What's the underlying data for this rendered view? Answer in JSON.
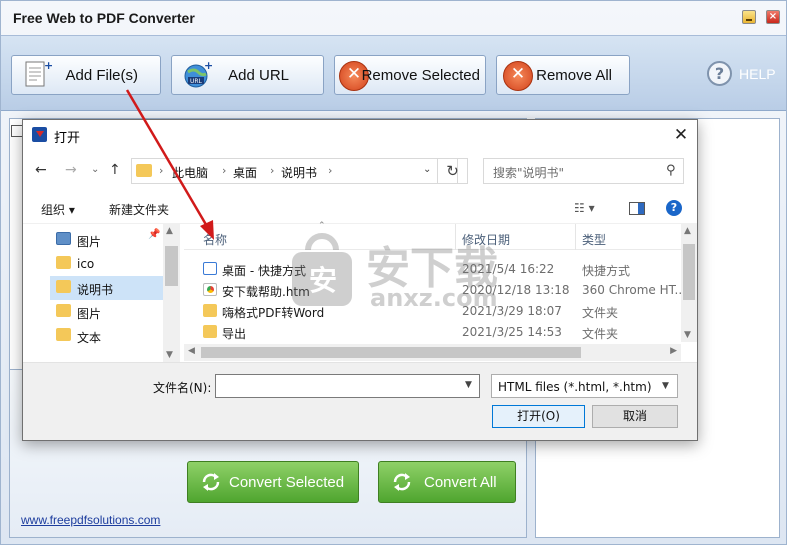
{
  "app": {
    "title": "Free Web to PDF Converter",
    "toolbar": {
      "add_files": "Add File(s)",
      "add_url": "Add URL",
      "remove_selected": "Remove Selected",
      "remove_all": "Remove All",
      "help": "HELP"
    },
    "convert_selected": "Convert Selected",
    "convert_all": "Convert All",
    "website": "www.freepdfsolutions.com"
  },
  "dialog": {
    "title": "打开",
    "breadcrumb": [
      "此电脑",
      "桌面",
      "说明书"
    ],
    "search_placeholder": "搜索\"说明书\"",
    "organize": "组织 ▾",
    "new_folder": "新建文件夹",
    "nav_tree": [
      {
        "label": "图片",
        "pinned": true
      },
      {
        "label": "ico"
      },
      {
        "label": "说明书",
        "selected": true
      },
      {
        "label": "图片"
      },
      {
        "label": "文本"
      }
    ],
    "columns": {
      "name": "名称",
      "modified": "修改日期",
      "type": "类型"
    },
    "files": [
      {
        "name": "桌面 - 快捷方式",
        "date": "2021/5/4 16:22",
        "type": "快捷方式"
      },
      {
        "name": "安下载帮助.htm",
        "date": "2020/12/18 13:18",
        "type": "360 Chrome HT..."
      },
      {
        "name": "嗨格式PDF转Word",
        "date": "2021/3/29 18:07",
        "type": "文件夹"
      },
      {
        "name": "导出",
        "date": "2021/3/25 14:53",
        "type": "文件夹"
      }
    ],
    "filename_label": "文件名(N):",
    "filename_value": "",
    "file_type": "HTML files (*.html, *.htm)",
    "open_button": "打开(O)",
    "cancel_button": "取消"
  },
  "watermark": {
    "text": "安下载",
    "sub": "anxz.com"
  },
  "colors": {
    "accent_green": "#4fa52f",
    "toolbar_blue": "#b9cde6",
    "arrow_red": "#d11a1a"
  }
}
